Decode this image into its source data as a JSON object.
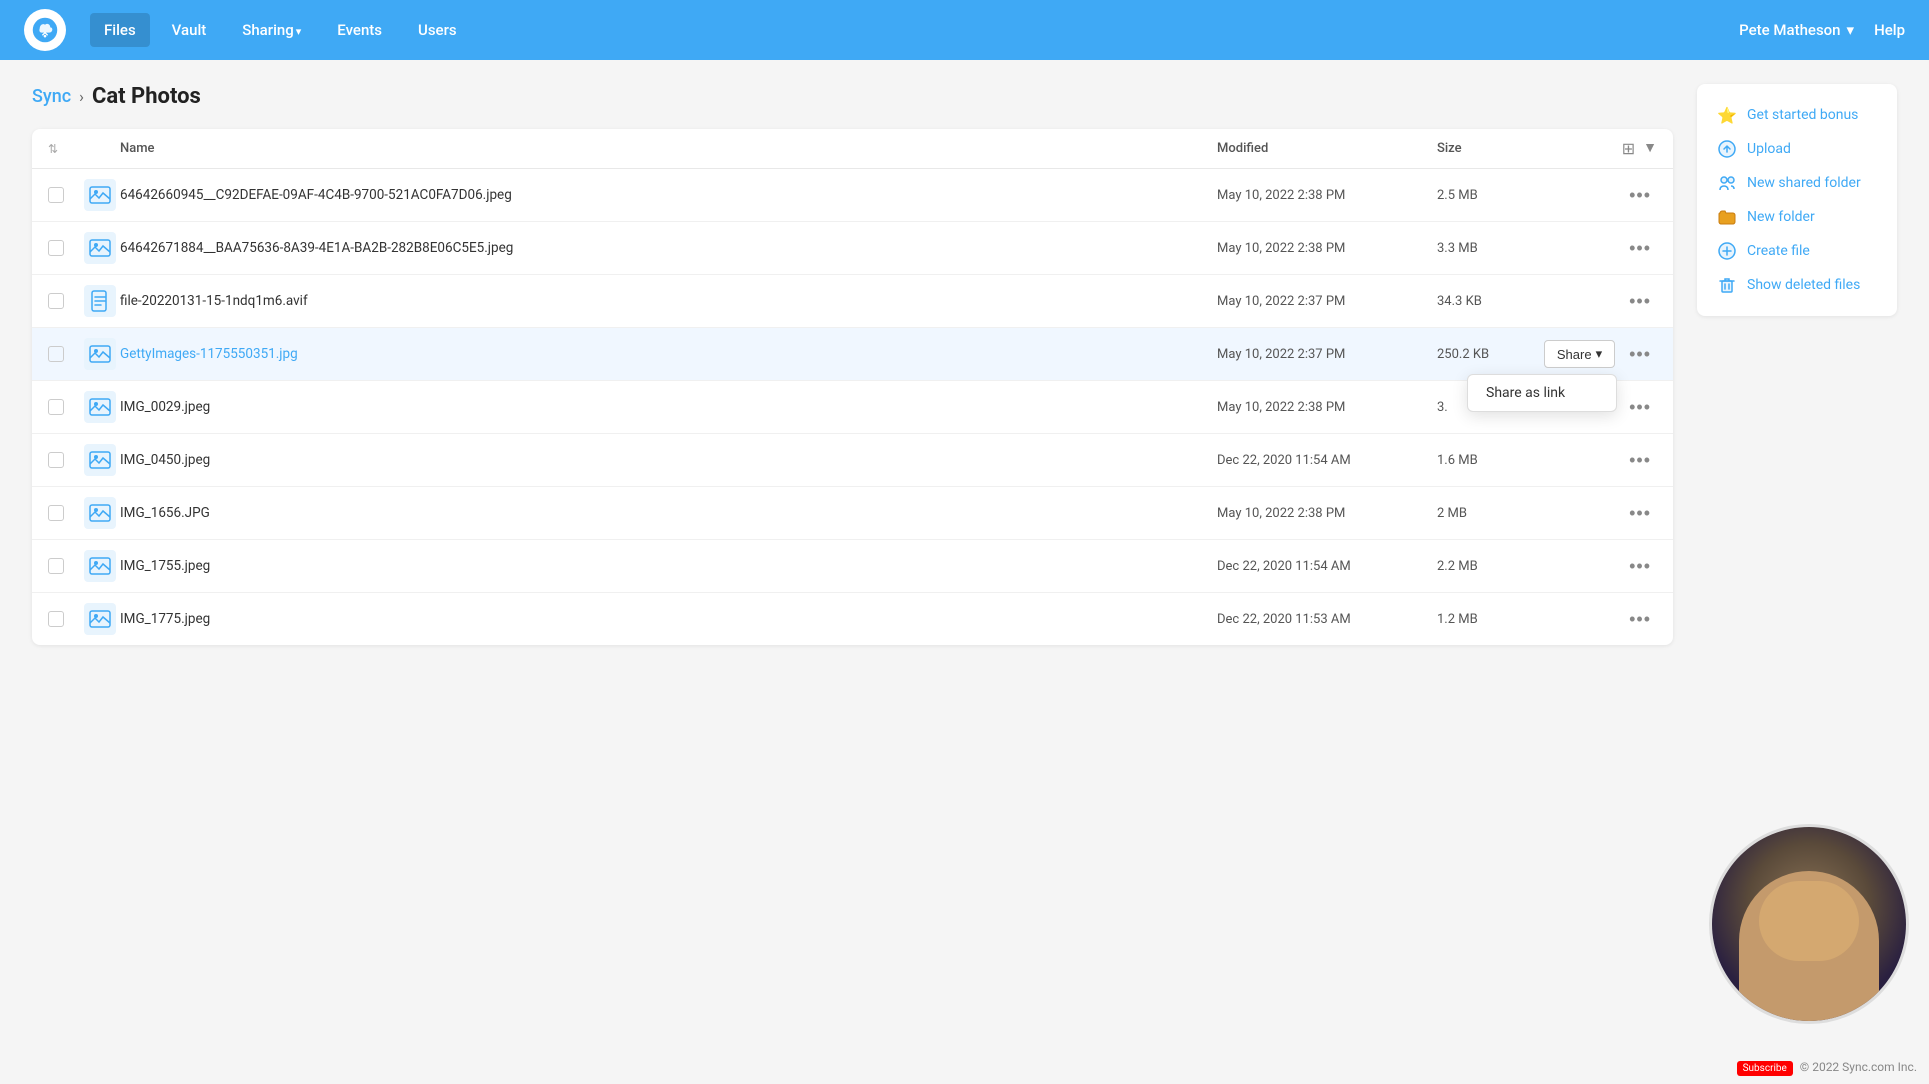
{
  "app": {
    "name": "Sync",
    "logo_alt": "Sync logo"
  },
  "navbar": {
    "links": [
      {
        "label": "Files",
        "active": true
      },
      {
        "label": "Vault",
        "active": false
      },
      {
        "label": "Sharing",
        "active": false,
        "has_arrow": true
      },
      {
        "label": "Events",
        "active": false
      },
      {
        "label": "Users",
        "active": false
      }
    ],
    "user": "Pete Matheson",
    "help": "Help"
  },
  "breadcrumb": {
    "parent": "Sync",
    "separator": "›",
    "current": "Cat Photos"
  },
  "table": {
    "columns": {
      "name": "Name",
      "modified": "Modified",
      "size": "Size"
    },
    "rows": [
      {
        "id": 1,
        "name": "64642660945__C92DEFAE-09AF-4C4B-9700-521AC0FA7D06.jpeg",
        "modified": "May 10, 2022 2:38 PM",
        "size": "2.5 MB",
        "type": "image",
        "highlighted": false
      },
      {
        "id": 2,
        "name": "64642671884__BAA75636-8A39-4E1A-BA2B-282B8E06C5E5.jpeg",
        "modified": "May 10, 2022 2:38 PM",
        "size": "3.3 MB",
        "type": "image",
        "highlighted": false
      },
      {
        "id": 3,
        "name": "file-20220131-15-1ndq1m6.avif",
        "modified": "May 10, 2022 2:37 PM",
        "size": "34.3 KB",
        "type": "doc",
        "highlighted": false
      },
      {
        "id": 4,
        "name": "GettyImages-1175550351.jpg",
        "modified": "May 10, 2022 2:37 PM",
        "size": "250.2 KB",
        "type": "image",
        "highlighted": true,
        "show_share": true,
        "share_dropdown": true
      },
      {
        "id": 5,
        "name": "IMG_0029.jpeg",
        "modified": "May 10, 2022 2:38 PM",
        "size": "3.",
        "type": "image",
        "highlighted": false
      },
      {
        "id": 6,
        "name": "IMG_0450.jpeg",
        "modified": "Dec 22, 2020 11:54 AM",
        "size": "1.6 MB",
        "type": "image",
        "highlighted": false
      },
      {
        "id": 7,
        "name": "IMG_1656.JPG",
        "modified": "May 10, 2022 2:38 PM",
        "size": "2 MB",
        "type": "image",
        "highlighted": false
      },
      {
        "id": 8,
        "name": "IMG_1755.jpeg",
        "modified": "Dec 22, 2020 11:54 AM",
        "size": "2.2 MB",
        "type": "image",
        "highlighted": false
      },
      {
        "id": 9,
        "name": "IMG_1775.jpeg",
        "modified": "Dec 22, 2020 11:53 AM",
        "size": "1.2 MB",
        "type": "image",
        "highlighted": false
      }
    ]
  },
  "share_dropdown": {
    "items": [
      "Share as link"
    ]
  },
  "share_button": {
    "label": "Share",
    "arrow": "▾"
  },
  "sidebar": {
    "items": [
      {
        "id": "get-started-bonus",
        "label": "Get started bonus",
        "icon": "⭐",
        "color": "#f5a623"
      },
      {
        "id": "upload",
        "label": "Upload",
        "icon": "☁",
        "color": "#3fa9f5"
      },
      {
        "id": "new-shared-folder",
        "label": "New shared folder",
        "icon": "👥",
        "color": "#3fa9f5"
      },
      {
        "id": "new-folder",
        "label": "New folder",
        "icon": "📁",
        "color": "#3fa9f5"
      },
      {
        "id": "create-file",
        "label": "Create file",
        "icon": "⊕",
        "color": "#3fa9f5"
      },
      {
        "id": "show-deleted-files",
        "label": "Show deleted files",
        "icon": "🗑",
        "color": "#3fa9f5"
      }
    ]
  },
  "footer": {
    "copyright": "© 2022 Sync.com Inc.",
    "badge": "Subscribe"
  }
}
